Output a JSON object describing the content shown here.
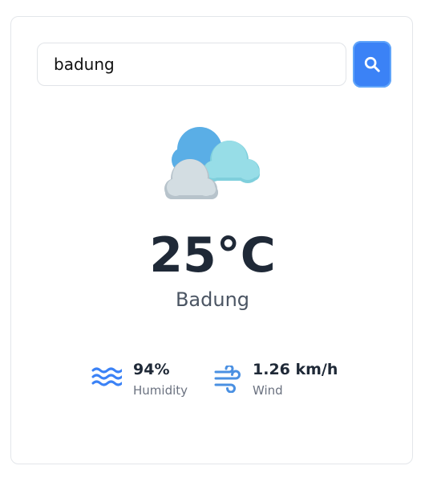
{
  "search": {
    "value": "badung",
    "placeholder": ""
  },
  "search_button": {
    "icon": "search-icon"
  },
  "weather": {
    "icon": "clouds-icon",
    "temperature": "25°C",
    "city": "Badung"
  },
  "stats": {
    "humidity": {
      "icon": "humidity-waves-icon",
      "value": "94%",
      "label": "Humidity"
    },
    "wind": {
      "icon": "wind-icon",
      "value": "1.26 km/h",
      "label": "Wind"
    }
  },
  "colors": {
    "accent": "#3b82f6",
    "temperature_text": "#1f2937",
    "muted_text": "#6b7280"
  }
}
